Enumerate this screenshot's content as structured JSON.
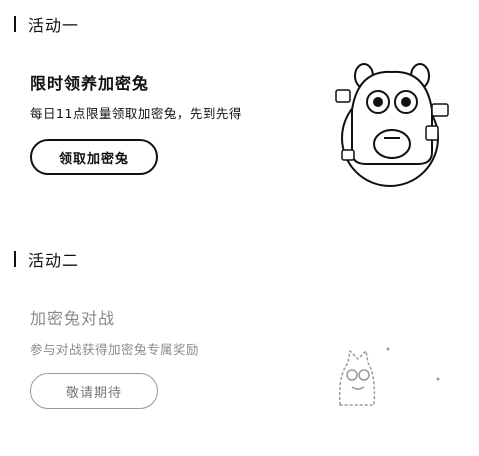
{
  "activity1": {
    "section_title": "活动一",
    "title": "限时领养加密兔",
    "description": "每日11点限量领取加密兔，先到先得",
    "button_label": "领取加密兔"
  },
  "activity2": {
    "section_title": "活动二",
    "title": "加密兔对战",
    "description": "参与对战获得加密兔专属奖励",
    "button_label": "敬请期待"
  },
  "colors": {
    "text": "#111111",
    "faded": "#8a8a8a",
    "background": "#ffffff"
  }
}
